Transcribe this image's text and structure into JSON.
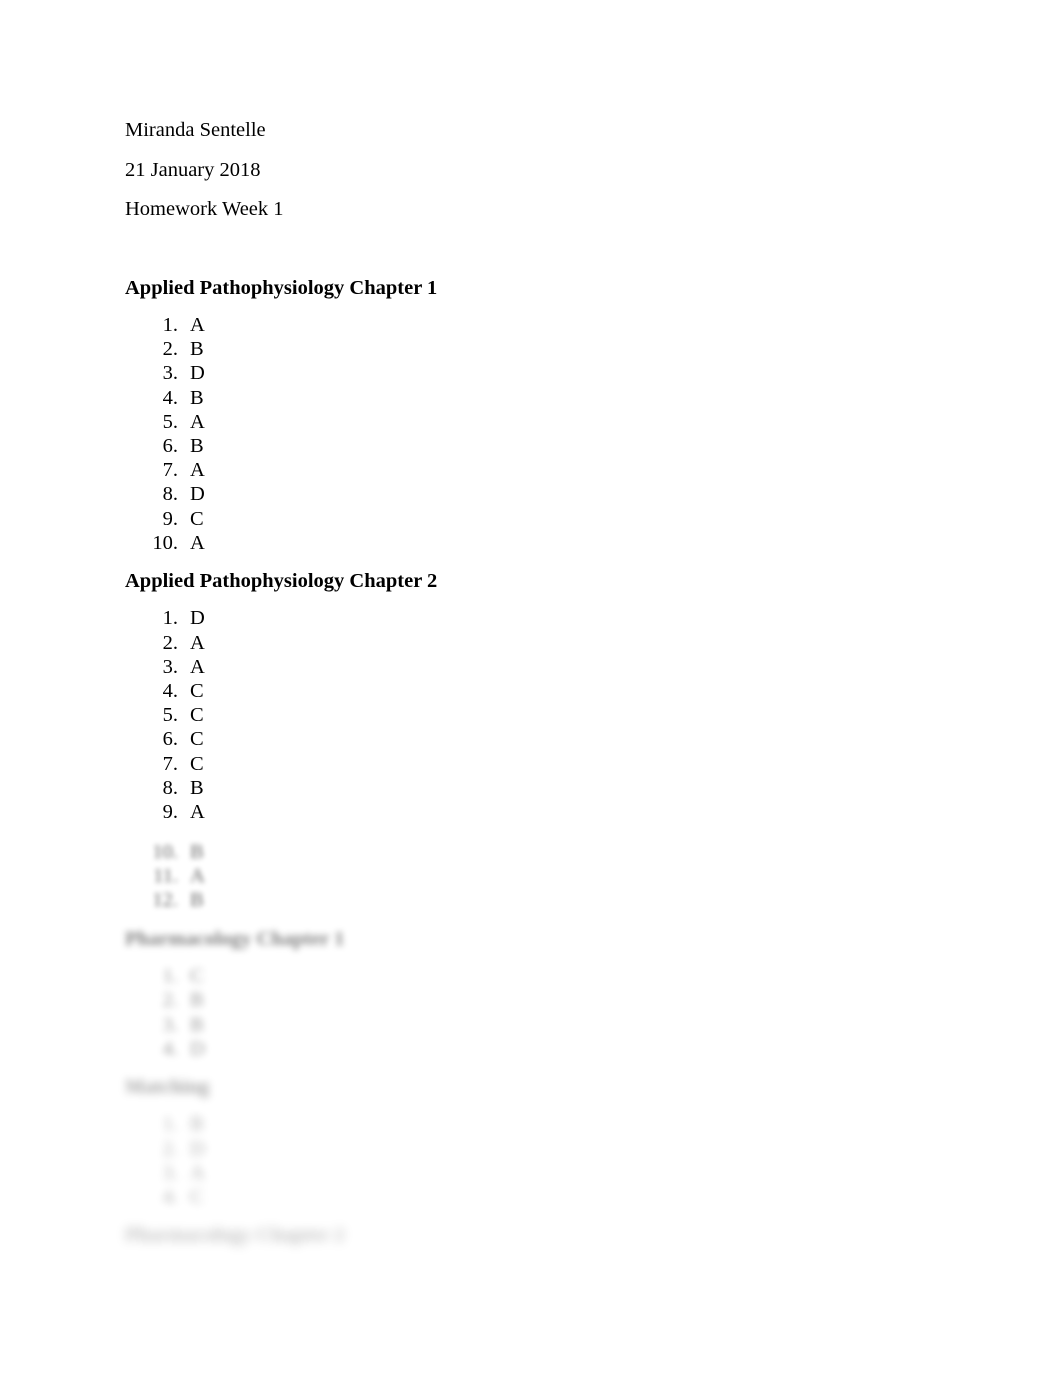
{
  "document": {
    "author": "Miranda Sentelle",
    "date": "21 January 2018",
    "assignment": "Homework Week 1"
  },
  "sections": [
    {
      "heading": "Applied Pathophysiology Chapter 1",
      "blurred": false,
      "items": [
        {
          "num": "1.",
          "value": "A"
        },
        {
          "num": "2.",
          "value": "B"
        },
        {
          "num": "3.",
          "value": "D"
        },
        {
          "num": "4.",
          "value": "B"
        },
        {
          "num": "5.",
          "value": "A"
        },
        {
          "num": "6.",
          "value": "B"
        },
        {
          "num": "7.",
          "value": "A"
        },
        {
          "num": "8.",
          "value": "D"
        },
        {
          "num": "9.",
          "value": "C"
        },
        {
          "num": "10.",
          "value": "A"
        }
      ]
    },
    {
      "heading": "Applied Pathophysiology Chapter 2",
      "blurred": false,
      "items": [
        {
          "num": "1.",
          "value": "D"
        },
        {
          "num": "2.",
          "value": "A"
        },
        {
          "num": "3.",
          "value": "A"
        },
        {
          "num": "4.",
          "value": "C"
        },
        {
          "num": "5.",
          "value": "C"
        },
        {
          "num": "6.",
          "value": "C"
        },
        {
          "num": "7.",
          "value": "C"
        },
        {
          "num": "8.",
          "value": "B"
        },
        {
          "num": "9.",
          "value": "A"
        }
      ]
    }
  ],
  "obscured": {
    "chapter2_tail": [
      {
        "num": "10.",
        "value": "B"
      },
      {
        "num": "11.",
        "value": "A"
      },
      {
        "num": "12.",
        "value": "B"
      }
    ],
    "pharmacology_1": {
      "heading": "Pharmacology Chapter 1",
      "items": [
        {
          "num": "1.",
          "value": "C"
        },
        {
          "num": "2.",
          "value": "B"
        },
        {
          "num": "3.",
          "value": "B"
        },
        {
          "num": "4.",
          "value": "D"
        }
      ]
    },
    "matching": {
      "heading": "Matching",
      "items": [
        {
          "num": "1.",
          "value": "B"
        },
        {
          "num": "2.",
          "value": "D"
        },
        {
          "num": "3.",
          "value": "A"
        },
        {
          "num": "4.",
          "value": "C"
        }
      ]
    },
    "pharmacology_2": {
      "heading": "Pharmacology Chapter 2"
    }
  }
}
